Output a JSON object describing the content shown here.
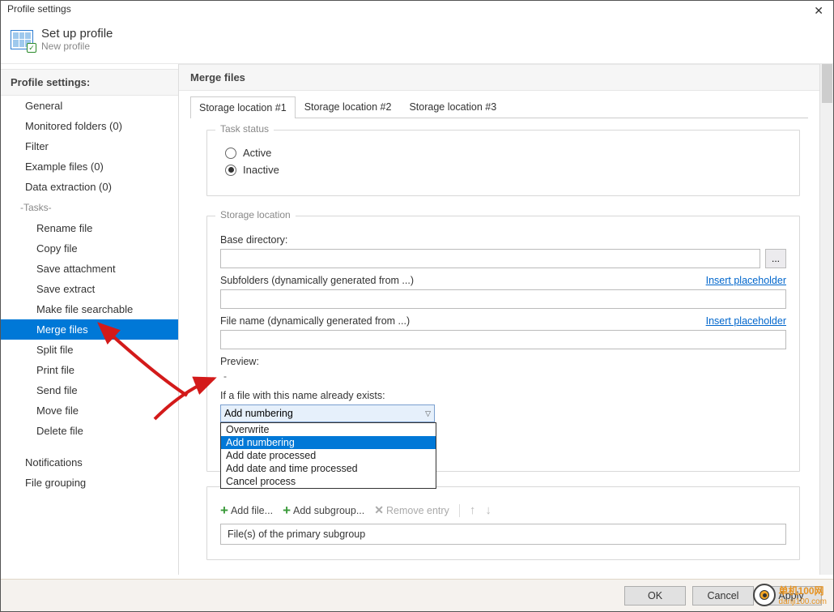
{
  "window": {
    "title": "Profile settings"
  },
  "header": {
    "title": "Set up profile",
    "subtitle": "New profile"
  },
  "sidebar": {
    "title": "Profile settings:",
    "items": [
      "General",
      "Monitored folders (0)",
      "Filter",
      "Example files  (0)",
      "Data extraction  (0)"
    ],
    "tasks_sep": "-Tasks-",
    "tasks": [
      "Rename file",
      "Copy file",
      "Save attachment",
      "Save extract",
      "Make file searchable",
      "Merge files",
      "Split file",
      "Print file",
      "Send file",
      "Move file",
      "Delete file"
    ],
    "bottom": [
      "Notifications",
      "File grouping"
    ],
    "selected": "Merge files"
  },
  "panel": {
    "title": "Merge files",
    "tabs": [
      "Storage location #1",
      "Storage location #2",
      "Storage location #3"
    ],
    "active_tab": 0,
    "task_status": {
      "legend": "Task status",
      "active": "Active",
      "inactive": "Inactive",
      "value": "Inactive"
    },
    "storage": {
      "legend": "Storage location",
      "base_dir_label": "Base directory:",
      "ellipsis": "...",
      "subfolders_label": "Subfolders (dynamically generated from ...)",
      "insert_placeholder": "Insert placeholder",
      "filename_label": "File name (dynamically generated from ...)",
      "preview_label": "Preview:",
      "preview_value": "-",
      "exists_label": "If a file with this name already exists:",
      "exists_value": "Add numbering",
      "exists_options": [
        "Overwrite",
        "Add numbering",
        "Add date processed",
        "Add date and time processed",
        "Cancel process"
      ]
    },
    "toolbar": {
      "add_file": "Add file...",
      "add_subgroup": "Add subgroup...",
      "remove": "Remove entry"
    },
    "list_item": "File(s) of the primary subgroup"
  },
  "footer": {
    "ok": "OK",
    "cancel": "Cancel",
    "apply": "Apply"
  },
  "watermark": {
    "line1": "单机100网",
    "line2": "danji100.com"
  }
}
